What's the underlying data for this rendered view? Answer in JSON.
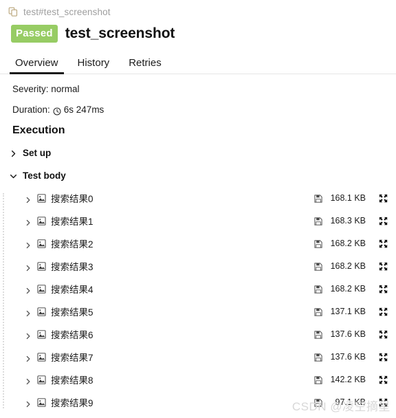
{
  "breadcrumb": {
    "icon": "copy-icon",
    "text": "test#test_screenshot"
  },
  "header": {
    "status_label": "Passed",
    "status_color": "#97cc64",
    "title": "test_screenshot"
  },
  "tabs": [
    {
      "label": "Overview",
      "active": true
    },
    {
      "label": "History",
      "active": false
    },
    {
      "label": "Retries",
      "active": false
    }
  ],
  "meta": {
    "severity_label": "Severity: normal",
    "duration_prefix": "Duration:",
    "duration_icon": "clock-icon",
    "duration_value": "6s 247ms"
  },
  "execution": {
    "section_title": "Execution",
    "nodes": [
      {
        "label": "Set up",
        "expanded": false
      },
      {
        "label": "Test body",
        "expanded": true
      }
    ]
  },
  "attachments": {
    "item_icon": "image-file-icon",
    "size_icon": "floppy-save-icon",
    "expand_icon": "expand-arrows-icon",
    "items": [
      {
        "label": "搜索结果0",
        "size": "168.1 KB"
      },
      {
        "label": "搜索结果1",
        "size": "168.3 KB"
      },
      {
        "label": "搜索结果2",
        "size": "168.2 KB"
      },
      {
        "label": "搜索结果3",
        "size": "168.2 KB"
      },
      {
        "label": "搜索结果4",
        "size": "168.2 KB"
      },
      {
        "label": "搜索结果5",
        "size": "137.1 KB"
      },
      {
        "label": "搜索结果6",
        "size": "137.6 KB"
      },
      {
        "label": "搜索结果7",
        "size": "137.6 KB"
      },
      {
        "label": "搜索结果8",
        "size": "142.2 KB"
      },
      {
        "label": "搜索结果9",
        "size": "97.1 KB"
      }
    ]
  },
  "watermark": {
    "text": "CSDN @凌空摘星"
  }
}
